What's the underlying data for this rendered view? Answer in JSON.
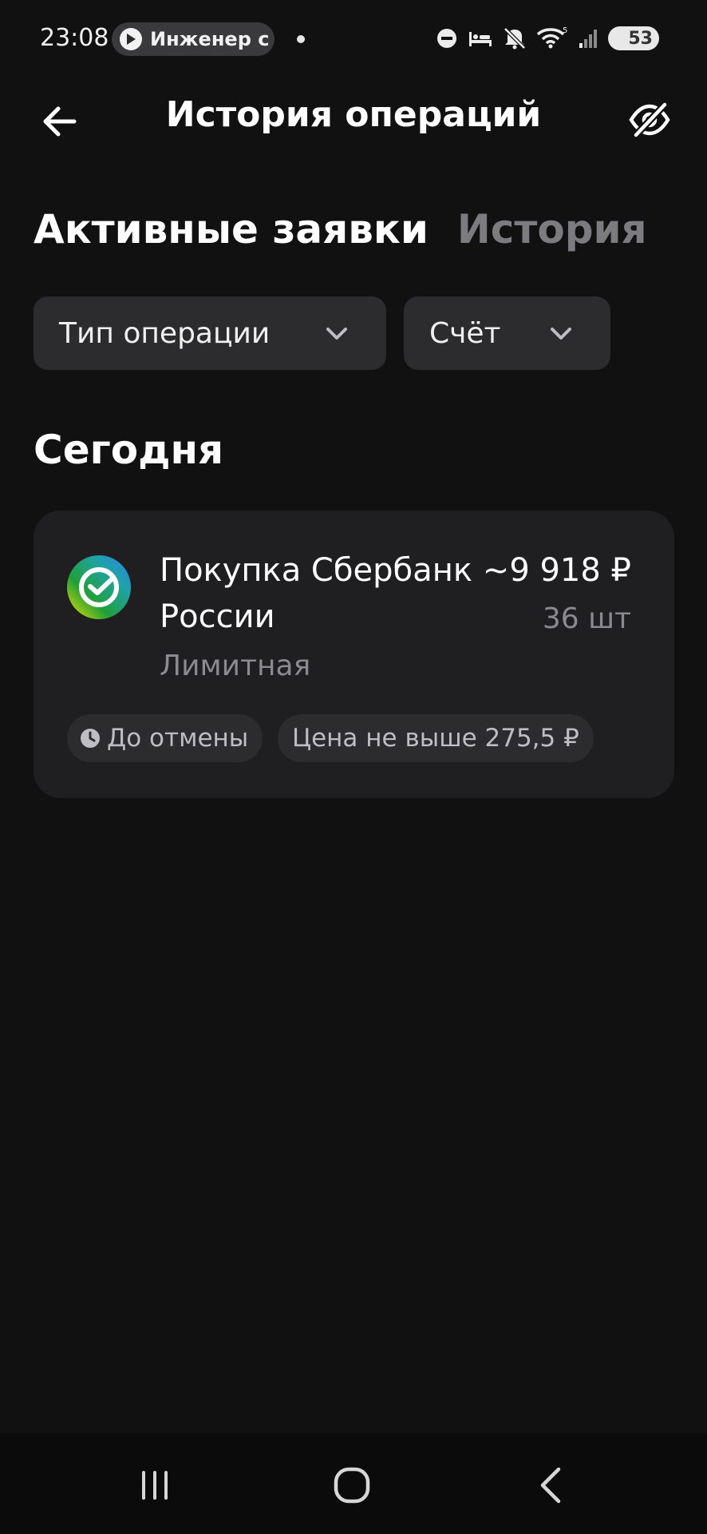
{
  "status_bar": {
    "time": "23:08",
    "media_text": "Инженер с",
    "battery": "53",
    "wifi_badge": "5"
  },
  "header": {
    "title": "История операций"
  },
  "tabs": [
    {
      "label": "Активные заявки",
      "active": true
    },
    {
      "label": "История",
      "active": false
    }
  ],
  "filters": [
    {
      "label": "Тип операции"
    },
    {
      "label": "Счёт"
    }
  ],
  "section": {
    "title": "Сегодня"
  },
  "operation": {
    "title": "Покупка Сбербанк России",
    "amount": "~9 918 ₽",
    "quantity": "36 шт",
    "type": "Лимитная",
    "chips": [
      {
        "label": "До отмены",
        "icon": "clock-icon"
      },
      {
        "label": "Цена не выше 275,5 ₽"
      }
    ]
  },
  "colors": {
    "background": "#111112",
    "card": "#1f1f21",
    "chip": "#2c2c2e",
    "muted_text": "#8a8a8f",
    "logo_green": "#21a038"
  }
}
